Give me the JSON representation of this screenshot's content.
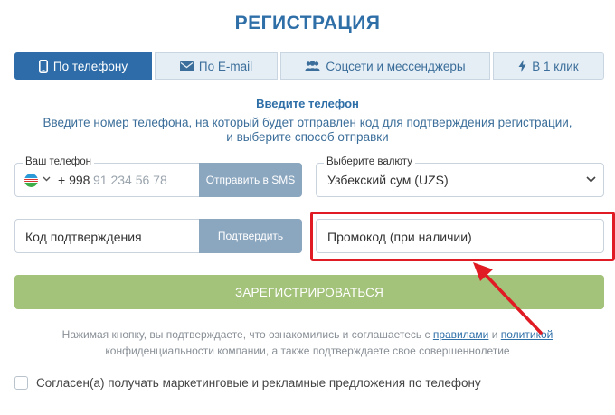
{
  "title": "РЕГИСТРАЦИЯ",
  "tabs": [
    {
      "label": "По телефону",
      "icon": "phone-icon",
      "active": true
    },
    {
      "label": "По E-mail",
      "icon": "envelope-icon",
      "active": false
    },
    {
      "label": "Соцсети и мессенджеры",
      "icon": "users-icon",
      "active": false
    },
    {
      "label": "В 1 клик",
      "icon": "lightning-icon",
      "active": false
    }
  ],
  "heading": "Введите телефон",
  "description_line1": "Введите номер телефона, на который будет отправлен код для подтверждения регистрации,",
  "description_line2": "и выберите способ отправки",
  "phone": {
    "label": "Ваш телефон",
    "country_code": "+ 998",
    "placeholder": "91 234 56 78",
    "send_button": "Отправить в SMS"
  },
  "currency": {
    "label": "Выберите валюту",
    "value": "Узбекский сум (UZS)"
  },
  "code": {
    "placeholder": "Код подтверждения",
    "confirm_button": "Подтвердить"
  },
  "promo": {
    "placeholder": "Промокод (при наличии)"
  },
  "register_button": "ЗАРЕГИСТРИРОВАТЬСЯ",
  "terms": {
    "before_rules": "Нажимая кнопку, вы подтверждаете, что ознакомились и соглашаетесь с ",
    "rules_link": "правилами",
    "and": " и ",
    "policy_link": "политикой",
    "after": " конфиденциальности компании, а также подтверждаете свое совершеннолетие"
  },
  "consent_label": "Согласен(а) получать маркетинговые и рекламные предложения по телефону",
  "colors": {
    "primary": "#2d6ca8",
    "register": "#a3c27a",
    "highlight": "#e01b24"
  }
}
